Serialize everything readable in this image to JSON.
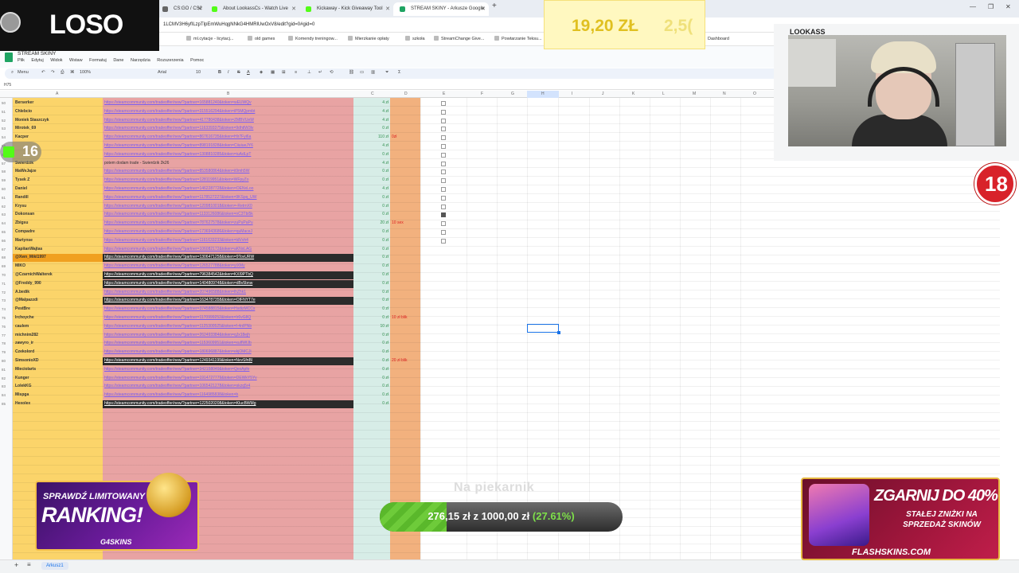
{
  "browser": {
    "tabs": [
      {
        "label": "CS:GO / CS2",
        "active": false
      },
      {
        "label": "About LookassCs - Watch Live",
        "active": false
      },
      {
        "label": "Kickaway - Kick Giveaway Tool",
        "active": false
      },
      {
        "label": "STREAM SKINY - Arkusze Google",
        "active": true
      }
    ],
    "url": "1LCMV3H6yfILzpTlpEmWuHqgNNkG4HMRlUwOxV8/edit?gid=0#gid=0",
    "bookmarks": [
      "ml.cytacje - licytacj...",
      "old games",
      "Komendy treningow...",
      "Mierzkanie opłaty",
      "szkoła",
      "StreamChange Give...",
      "Powtarzanie Teksu..."
    ],
    "dashboard": "Dashboard"
  },
  "sheets": {
    "title": "STREAM SKINY",
    "menus": [
      "Plik",
      "Edytuj",
      "Widok",
      "Wstaw",
      "Formatuj",
      "Dane",
      "Narzędzia",
      "Rozszerzenia",
      "Pomoc"
    ],
    "toolbar": {
      "menu": "Menu",
      "zoom": "100%",
      "font": "Arial",
      "font_size": "10"
    },
    "name_box": "H75",
    "sheet_tab": "Arkusz1",
    "rows": [
      {
        "n": "50",
        "name": "Berserker",
        "link": "https://steamcommunity.com/tradeoffer/new/?partner=165881240&token=wEUWQv",
        "amt": "4 zł",
        "note": "",
        "cb": false,
        "style": ""
      },
      {
        "n": "51",
        "name": "Chlebcio",
        "link": "https://steamcommunity.com/tradeoffer/new/?partner=315516294&token=iP5MQpmbt",
        "amt": "4 zł",
        "note": "",
        "cb": false,
        "style": ""
      },
      {
        "n": "52",
        "name": "Moniek Staszczyk",
        "link": "https://steamcommunity.com/tradeoffer/new/?partner=417780438&token=ZMBVUeW",
        "amt": "4 zł",
        "note": "",
        "cb": false,
        "style": ""
      },
      {
        "n": "53",
        "name": "Mirotek_69",
        "link": "https://steamcommunity.com/tradeoffer/new/?partner=1163393375&token=9dhtlW3lv",
        "amt": "0 zł",
        "note": "",
        "cb": false,
        "style": ""
      },
      {
        "n": "54",
        "name": "Kacper",
        "link": "https://steamcommunity.com/tradeoffer/new/?partner=867616735&token=Hlr7Fyi6a",
        "amt": "110 zł",
        "note": "0zł",
        "cb": false,
        "style": ""
      },
      {
        "n": "55",
        "name": "",
        "link": "https://steamcommunity.com/tradeoffer/new/?partner=898191828&token=CiiuiueJY6",
        "amt": "4 zł",
        "note": "",
        "cb": false,
        "style": ""
      },
      {
        "n": "56",
        "name": "",
        "link": "https://steamcommunity.com/tradeoffer/new/?partner=1308810285&token=iuAdLpT",
        "amt": "0 zł",
        "note": "",
        "cb": false,
        "style": ""
      },
      {
        "n": "57",
        "name": "Swierdzik",
        "link": "potem dodam trade - Swierdzik 2k26",
        "amt": "4 zł",
        "note": "",
        "cb": false,
        "style": "plain"
      },
      {
        "n": "58",
        "name": "MaWeJajze",
        "link": "https://steamcommunity.com/tradeoffer/new/?partner=853580864&token=ii9mh5W",
        "amt": "0 zł",
        "note": "",
        "cb": false,
        "style": ""
      },
      {
        "n": "59",
        "name": "Tysek Z",
        "link": "https://steamcommunity.com/tradeoffer/new/?partner=128119951&token=WFpyZo",
        "amt": "0 zł",
        "note": "",
        "cb": false,
        "style": ""
      },
      {
        "n": "60",
        "name": "Daniel",
        "link": "https://steamcommunity.com/tradeoffer/new/?partner=1462287728&token=OENxLoo",
        "amt": "4 zł",
        "note": "",
        "cb": false,
        "style": ""
      },
      {
        "n": "61",
        "name": "Randill",
        "link": "https://steamcommunity.com/tradeoffer/new/?partner=1178527227&token=9KSpq_UW",
        "amt": "0 zł",
        "note": "",
        "cb": false,
        "style": ""
      },
      {
        "n": "62",
        "name": "Krysu",
        "link": "https://steamcommunity.com/tradeoffer/new/?partner=1209810018&token=-RetrnX0",
        "amt": "0 zł",
        "note": "",
        "cb": false,
        "style": ""
      },
      {
        "n": "63",
        "name": "Dokonsan",
        "link": "https://steamcommunity.com/tradeoffer/new/?partner=1133126086&token=nC3Tbi5k",
        "amt": "0 zł",
        "note": "",
        "cb": true,
        "style": ""
      },
      {
        "n": "64",
        "name": "Zbigsu",
        "link": "https://steamcommunity.com/tradeoffer/new/?partner=787627578&token=zuPuPaPu",
        "amt": "20 zł",
        "note": "10 sex",
        "cb": false,
        "style": ""
      },
      {
        "n": "65",
        "name": "Compadre",
        "link": "https://steamcommunity.com/tradeoffer/new/?partner=1736943686&token=quMaceJ",
        "amt": "0 zł",
        "note": "",
        "cb": false,
        "style": ""
      },
      {
        "n": "66",
        "name": "Martynse",
        "link": "https://steamcommunity.com/tradeoffer/new/?partner=1161633233&token=tdVvh4",
        "amt": "0 zł",
        "note": "",
        "cb": false,
        "style": ""
      },
      {
        "n": "67",
        "name": "KapitanWajtas",
        "link": "https://steamcommunity.com/tradeoffer/new/?partner=106082172&token=aKNxLAG",
        "amt": "0 zł",
        "note": "",
        "cb": false,
        "style": ""
      },
      {
        "n": "68",
        "name": "@Xwn_Mikl1997",
        "link": "https://steamcommunity.com/tradeoffer/new/?partner=1306471258&token=9TovURW",
        "amt": "0 zł",
        "note": "",
        "cb": false,
        "style": "dark-hl"
      },
      {
        "n": "69",
        "name": "MIKO",
        "link": "https://steamcommunity.com/tradeoffer/new/?partner=126527788&token=yiXMy",
        "amt": "0 zł",
        "note": "",
        "cb": false,
        "style": ""
      },
      {
        "n": "70",
        "name": "@CzarnichWalterek",
        "link": "https://steamcommunity.com/tradeoffer/new/?partner=796384542&token=KXI9PTbQ",
        "amt": "0 zł",
        "note": "",
        "cb": false,
        "style": "dark"
      },
      {
        "n": "71",
        "name": "@Freddy_990",
        "link": "https://steamcommunity.com/tradeoffer/new/?partner=1404809748&token=dBv5bnw",
        "amt": "0 zł",
        "note": "",
        "cb": false,
        "style": "dark"
      },
      {
        "n": "72",
        "name": "A.bedik",
        "link": "https://steamcommunity.com/tradeoffer/new/?partner=207496588&token=lhZhk1",
        "amt": "0 zł",
        "note": "",
        "cb": false,
        "style": ""
      },
      {
        "n": "73",
        "name": "@Malpazzdi",
        "link": "https://steamcommunity.com/tradeoffer/new/?partner=1634787358&token=OIFNYT7e",
        "amt": "0 zł",
        "note": "",
        "cb": false,
        "style": "dark"
      },
      {
        "n": "74",
        "name": "PestBre",
        "link": "https://steamcommunity.com/tradeoffer/new/?partner=374588815&token=HsdizMCCs",
        "amt": "0 zł",
        "note": "",
        "cb": false,
        "style": ""
      },
      {
        "n": "75",
        "name": "Irchoyche",
        "link": "https://steamcommunity.com/tradeoffer/new/?partner=1170999252&token=Ir6vG8Q",
        "amt": "0 zł",
        "note": "10 zł blik",
        "cb": false,
        "style": ""
      },
      {
        "n": "76",
        "name": "caulem",
        "link": "https://steamcommunity.com/tradeoffer/new/?partner=1125300525&token=f-4nIPNb",
        "amt": "10 zł",
        "note": "",
        "cb": false,
        "style": ""
      },
      {
        "n": "77",
        "name": "michnim282",
        "link": "https://steamcommunity.com/tradeoffer/new/?partner=262493384&token=qJx18ejh",
        "amt": "0 zł",
        "note": "",
        "cb": false,
        "style": ""
      },
      {
        "n": "78",
        "name": "zawyro_ir",
        "link": "https://steamcommunity.com/tradeoffer/new/?partner=1153609951&token=xuIfWfJb",
        "amt": "0 zł",
        "note": "",
        "cb": false,
        "style": ""
      },
      {
        "n": "79",
        "name": "Czekolord",
        "link": "https://steamcommunity.com/tradeoffer/new/?partner=180696887&token=ekjOMCJi",
        "amt": "0 zł",
        "note": "",
        "cb": false,
        "style": ""
      },
      {
        "n": "80",
        "name": "SimsonioXD",
        "link": "https://steamcommunity.com/tradeoffer/new/?partner=1249341199&token=NvvSfnBl",
        "amt": "0 zł",
        "note": "20 zł blik",
        "cb": false,
        "style": "dark"
      },
      {
        "n": "81",
        "name": "Mieciolarts",
        "link": "https://steamcommunity.com/tradeoffer/new/?partner=342158049&token=QexApfe",
        "amt": "0 zł",
        "note": "",
        "cb": false,
        "style": ""
      },
      {
        "n": "82",
        "name": "Kunger",
        "link": "https://steamcommunity.com/tradeoffer/new/?partner=1914727779&token=DEWkY5Yv",
        "amt": "0 zł",
        "note": "",
        "cb": false,
        "style": ""
      },
      {
        "n": "83",
        "name": "LolekKG",
        "link": "https://steamcommunity.com/tradeoffer/new/?partner=1065421278&token=skzq5r4",
        "amt": "0 zł",
        "note": "",
        "cb": false,
        "style": ""
      },
      {
        "n": "84",
        "name": "Mispga",
        "link": "https://steamcommunity.com/tradeoffer/new/?partner=1164985838&token=b",
        "amt": "0 zł",
        "note": "",
        "cb": false,
        "style": ""
      },
      {
        "n": "85",
        "name": "Hexolex",
        "link": "https://steamcommunity.com/tradeoffer/new/?partner=1225020208&token=KlucBWMg",
        "amt": "0 zł",
        "note": "",
        "cb": false,
        "style": "dark"
      }
    ]
  },
  "overlay": {
    "logo": "LOSO",
    "badge_count": "16",
    "price_primary": "19,20 ZŁ",
    "price_secondary": "2,5(",
    "webcam_label": "LOOKASS",
    "age_rating": "18",
    "ranking": {
      "line1": "SPRAWDŹ LIMITOWANY",
      "line2": "RANKING!",
      "brand": "G4SKINS"
    },
    "goal": {
      "label": "Na piekarnik",
      "current": "276,15 zł",
      "sep": "z",
      "target": "1000,00 zł",
      "percent": "(27.61%)",
      "fraction": 0.2761
    },
    "flash": {
      "headline": "ZGARNIJ DO 40%",
      "sub": "STAŁEJ ZNIŻKI NA SPRZEDAŻ SKINÓW",
      "brand": "FLASHSKINS.COM"
    }
  }
}
